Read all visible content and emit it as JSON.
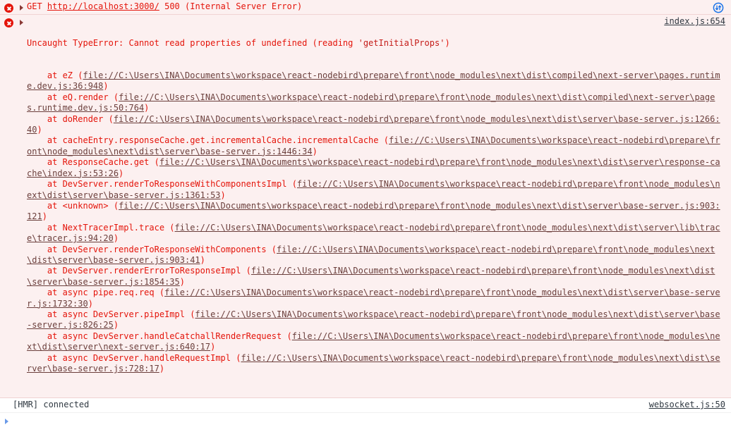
{
  "console": {
    "messages": [
      {
        "kind": "network-error",
        "icon": "error-circle-icon",
        "expander": "collapsed-triangle-icon",
        "method": "GET",
        "url": "http://localhost:3000/",
        "status": "500",
        "status_text": "(Internal Server Error)",
        "right_icon": "network-request-icon"
      },
      {
        "kind": "js-error",
        "icon": "error-circle-icon",
        "expander": "collapsed-triangle-icon",
        "headline_prefix": "Uncaught TypeError: Cannot read properties of undefined (reading ",
        "headline_quoted": "'getInitialProps'",
        "headline_suffix": ")",
        "source_link": "index.js:654",
        "stack": [
          {
            "fn": "    at eZ (",
            "loc": "file://C:\\Users\\INA\\Documents\\workspace\\react-nodebird\\prepare\\front\\node_modules\\next\\dist\\compiled\\next-server\\pages.runtime.dev.js:36:948",
            "close": ")"
          },
          {
            "fn": "    at eQ.render (",
            "loc": "file://C:\\Users\\INA\\Documents\\workspace\\react-nodebird\\prepare\\front\\node_modules\\next\\dist\\compiled\\next-server\\pages.runtime.dev.js:50:764",
            "close": ")"
          },
          {
            "fn": "    at doRender (",
            "loc": "file://C:\\Users\\INA\\Documents\\workspace\\react-nodebird\\prepare\\front\\node_modules\\next\\dist\\server\\base-server.js:1266:40",
            "close": ")"
          },
          {
            "fn": "    at cacheEntry.responseCache.get.incrementalCache.incrementalCache (",
            "loc": "file://C:\\Users\\INA\\Documents\\workspace\\react-nodebird\\prepare\\front\\node_modules\\next\\dist\\server\\base-server.js:1446:34",
            "close": ")"
          },
          {
            "fn": "    at ResponseCache.get (",
            "loc": "file://C:\\Users\\INA\\Documents\\workspace\\react-nodebird\\prepare\\front\\node_modules\\next\\dist\\server\\response-cache\\index.js:53:26",
            "close": ")"
          },
          {
            "fn": "    at DevServer.renderToResponseWithComponentsImpl (",
            "loc": "file://C:\\Users\\INA\\Documents\\workspace\\react-nodebird\\prepare\\front\\node_modules\\next\\dist\\server\\base-server.js:1361:53",
            "close": ")"
          },
          {
            "fn": "    at <unknown> (",
            "loc": "file://C:\\Users\\INA\\Documents\\workspace\\react-nodebird\\prepare\\front\\node_modules\\next\\dist\\server\\base-server.js:903:121",
            "close": ")"
          },
          {
            "fn": "    at NextTracerImpl.trace (",
            "loc": "file://C:\\Users\\INA\\Documents\\workspace\\react-nodebird\\prepare\\front\\node_modules\\next\\dist\\server\\lib\\trace\\tracer.js:94:20",
            "close": ")"
          },
          {
            "fn": "    at DevServer.renderToResponseWithComponents (",
            "loc": "file://C:\\Users\\INA\\Documents\\workspace\\react-nodebird\\prepare\\front\\node_modules\\next\\dist\\server\\base-server.js:903:41",
            "close": ")"
          },
          {
            "fn": "    at DevServer.renderErrorToResponseImpl (",
            "loc": "file://C:\\Users\\INA\\Documents\\workspace\\react-nodebird\\prepare\\front\\node_modules\\next\\dist\\server\\base-server.js:1854:35",
            "close": ")"
          },
          {
            "fn": "    at async pipe.req.req (",
            "loc": "file://C:\\Users\\INA\\Documents\\workspace\\react-nodebird\\prepare\\front\\node_modules\\next\\dist\\server\\base-server.js:1732:30",
            "close": ")"
          },
          {
            "fn": "    at async DevServer.pipeImpl (",
            "loc": "file://C:\\Users\\INA\\Documents\\workspace\\react-nodebird\\prepare\\front\\node_modules\\next\\dist\\server\\base-server.js:826:25",
            "close": ")"
          },
          {
            "fn": "    at async DevServer.handleCatchallRenderRequest (",
            "loc": "file://C:\\Users\\INA\\Documents\\workspace\\react-nodebird\\prepare\\front\\node_modules\\next\\dist\\server\\next-server.js:640:17",
            "close": ")"
          },
          {
            "fn": "    at async DevServer.handleRequestImpl (",
            "loc": "file://C:\\Users\\INA\\Documents\\workspace\\react-nodebird\\prepare\\front\\node_modules\\next\\dist\\server\\base-server.js:728:17",
            "close": ")"
          }
        ]
      },
      {
        "kind": "info",
        "text": "[HMR] connected",
        "source_link": "websocket.js:50"
      }
    ],
    "prompt": {
      "caret": "prompt-caret-icon",
      "value": ""
    }
  },
  "colors": {
    "error_text": "#e4140a",
    "error_bg": "#fcf0f0",
    "link": "#6b3f3c",
    "info_text": "#303942",
    "prompt_caret": "#6a9ae8",
    "net_icon": "#1a73e8"
  }
}
